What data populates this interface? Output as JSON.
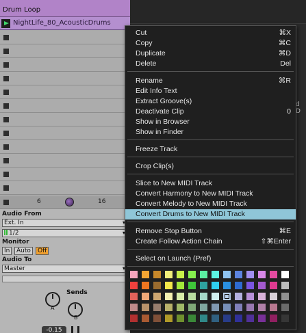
{
  "track": {
    "title": "Drum Loop",
    "clip_name": "NightLife_80_AcousticDrums",
    "control_left": "6",
    "control_right": "16"
  },
  "io": {
    "audio_from_label": "Audio From",
    "audio_from_value": "Ext. In",
    "channel_value": "1/2",
    "monitor_label": "Monitor",
    "monitor_in": "In",
    "monitor_auto": "Auto",
    "monitor_off": "Off",
    "audio_to_label": "Audio To",
    "audio_to_value": "Master",
    "sends_label": "Sends",
    "send_a": "A",
    "send_b": "B",
    "volume": "-0.15"
  },
  "background": {
    "peek_text": "d D"
  },
  "menu": {
    "items": [
      {
        "label": "Cut",
        "shortcut": "⌘X"
      },
      {
        "label": "Copy",
        "shortcut": "⌘C"
      },
      {
        "label": "Duplicate",
        "shortcut": "⌘D"
      },
      {
        "label": "Delete",
        "shortcut": "Del"
      },
      {
        "label": "Rename",
        "shortcut": "⌘R"
      },
      {
        "label": "Edit Info Text",
        "shortcut": ""
      },
      {
        "label": "Extract Groove(s)",
        "shortcut": ""
      },
      {
        "label": "Deactivate Clip",
        "shortcut": "0"
      },
      {
        "label": "Show in Browser",
        "shortcut": ""
      },
      {
        "label": "Show in Finder",
        "shortcut": ""
      },
      {
        "label": "Freeze Track",
        "shortcut": ""
      },
      {
        "label": "Crop Clip(s)",
        "shortcut": ""
      },
      {
        "label": "Slice to New MIDI Track",
        "shortcut": ""
      },
      {
        "label": "Convert Harmony to New MIDI Track",
        "shortcut": ""
      },
      {
        "label": "Convert Melody to New MIDI Track",
        "shortcut": ""
      },
      {
        "label": "Convert Drums to New MIDI Track",
        "shortcut": "",
        "highlighted": true
      },
      {
        "label": "Remove Stop Button",
        "shortcut": "⌘E"
      },
      {
        "label": "Create Follow Action Chain",
        "shortcut": "⇧⌘Enter"
      },
      {
        "label": "Select on Launch (Pref)",
        "shortcut": ""
      }
    ],
    "palette": {
      "selected_index": 36,
      "colors": [
        "#f5a5bd",
        "#f4a533",
        "#c8882a",
        "#f2ee7a",
        "#c9f04a",
        "#86f04e",
        "#5cf0a3",
        "#5cf5e3",
        "#8fc3f0",
        "#5c84e0",
        "#a28ff0",
        "#d887e8",
        "#e54ba0",
        "#ffffff",
        "#f0413d",
        "#f07620",
        "#9a6b2e",
        "#f5e84a",
        "#a3e83a",
        "#3fc83a",
        "#2ea3a0",
        "#2fd0f0",
        "#2a90e0",
        "#2e6bd0",
        "#7a55e0",
        "#a45ad0",
        "#e03a90",
        "#bdbdbd",
        "#e2625a",
        "#f0a877",
        "#cda670",
        "#f5f0b0",
        "#d8eca8",
        "#b8dca0",
        "#a5d8c8",
        "#d0f0f0",
        "#b8d0ec",
        "#b3b0e0",
        "#b890d8",
        "#d8b0d8",
        "#d8d0d8",
        "#8f8f8f",
        "#c08a8a",
        "#b8926a",
        "#987e6e",
        "#b8b06a",
        "#a0b868",
        "#80a878",
        "#80a8a0",
        "#8098b0",
        "#7890b8",
        "#8080b8",
        "#9878b0",
        "#b080a8",
        "#b87890",
        "#6a6a6a",
        "#b03030",
        "#a85a32",
        "#805038",
        "#b09a28",
        "#70902e",
        "#3a8838",
        "#308888",
        "#306080",
        "#283c88",
        "#303098",
        "#503098",
        "#783098",
        "#902060",
        "#363636"
      ]
    }
  }
}
